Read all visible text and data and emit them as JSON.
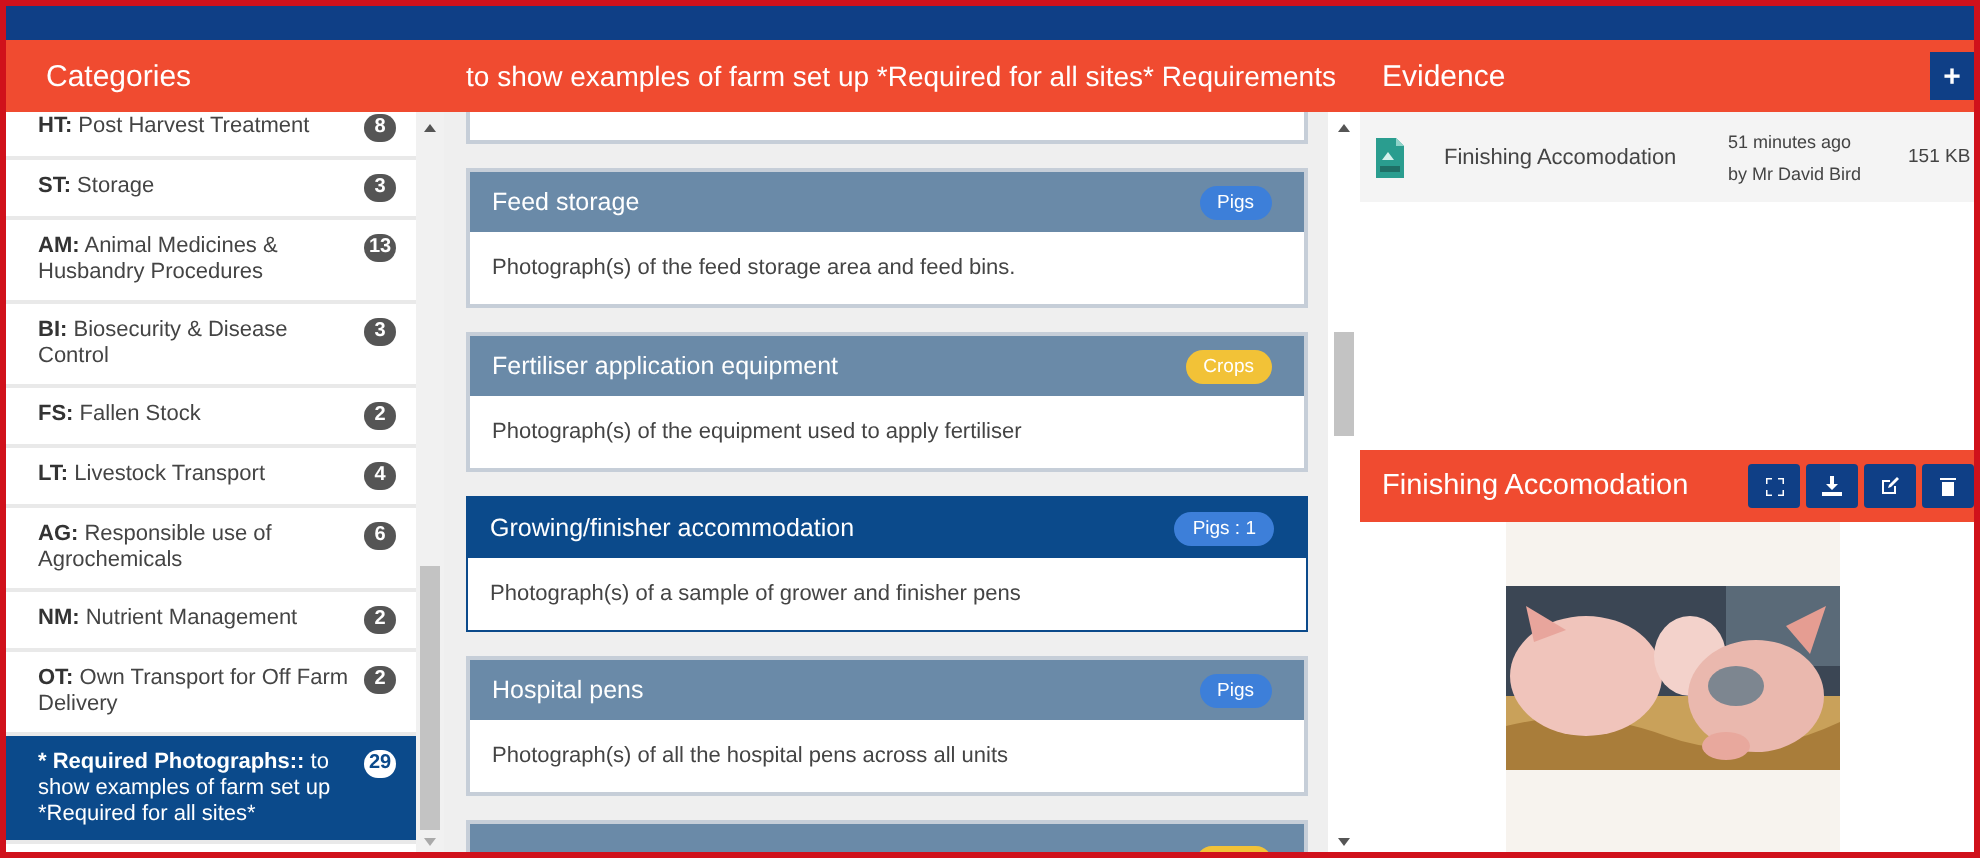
{
  "header": {
    "categories_title": "Categories",
    "requirements_title": "to show examples of farm set up *Required for all sites* Requirements",
    "evidence_title": "Evidence",
    "add_button": "+"
  },
  "categories": [
    {
      "code": "HT:",
      "name": "Post Harvest Treatment",
      "count": "8",
      "selected": false
    },
    {
      "code": "ST:",
      "name": "Storage",
      "count": "3",
      "selected": false
    },
    {
      "code": "AM:",
      "name": "Animal Medicines & Husbandry Procedures",
      "count": "13",
      "selected": false
    },
    {
      "code": "BI:",
      "name": "Biosecurity & Disease Control",
      "count": "3",
      "selected": false
    },
    {
      "code": "FS:",
      "name": "Fallen Stock",
      "count": "2",
      "selected": false
    },
    {
      "code": "LT:",
      "name": "Livestock Transport",
      "count": "4",
      "selected": false
    },
    {
      "code": "AG:",
      "name": "Responsible use of Agrochemicals",
      "count": "6",
      "selected": false
    },
    {
      "code": "NM:",
      "name": "Nutrient Management",
      "count": "2",
      "selected": false
    },
    {
      "code": "OT:",
      "name": "Own Transport for Off Farm Delivery",
      "count": "2",
      "selected": false
    },
    {
      "code": "* Required Photographs::",
      "name": "to show examples of farm set up *Required for all sites*",
      "count": "29",
      "selected": true
    }
  ],
  "requirements": [
    {
      "kind": "tail"
    },
    {
      "kind": "full",
      "title": "Feed storage",
      "tag": {
        "label": "Pigs",
        "color": "#3d7fd9"
      },
      "description": "Photograph(s) of the feed storage area and feed bins.",
      "selected": false
    },
    {
      "kind": "full",
      "title": "Fertiliser application equipment",
      "tag": {
        "label": "Crops",
        "color": "#f2c237"
      },
      "description": "Photograph(s) of the equipment used to apply fertiliser",
      "selected": false
    },
    {
      "kind": "full",
      "title": "Growing/finisher accommodation",
      "tag": {
        "label": "Pigs : 1",
        "color": "#3d7fd9"
      },
      "description": "Photograph(s) of a sample of grower and finisher pens",
      "selected": true
    },
    {
      "kind": "full",
      "title": "Hospital pens",
      "tag": {
        "label": "Pigs",
        "color": "#3d7fd9"
      },
      "description": "Photograph(s) of all the hospital pens across all units",
      "selected": false
    },
    {
      "kind": "head",
      "tag": {
        "color": "#f2c237"
      }
    }
  ],
  "evidence": {
    "files": [
      {
        "name": "Finishing Accomodation",
        "time": "51 minutes ago",
        "author": "by Mr David Bird",
        "size": "151 KB"
      }
    ],
    "preview": {
      "title": "Finishing Accomodation"
    }
  }
}
